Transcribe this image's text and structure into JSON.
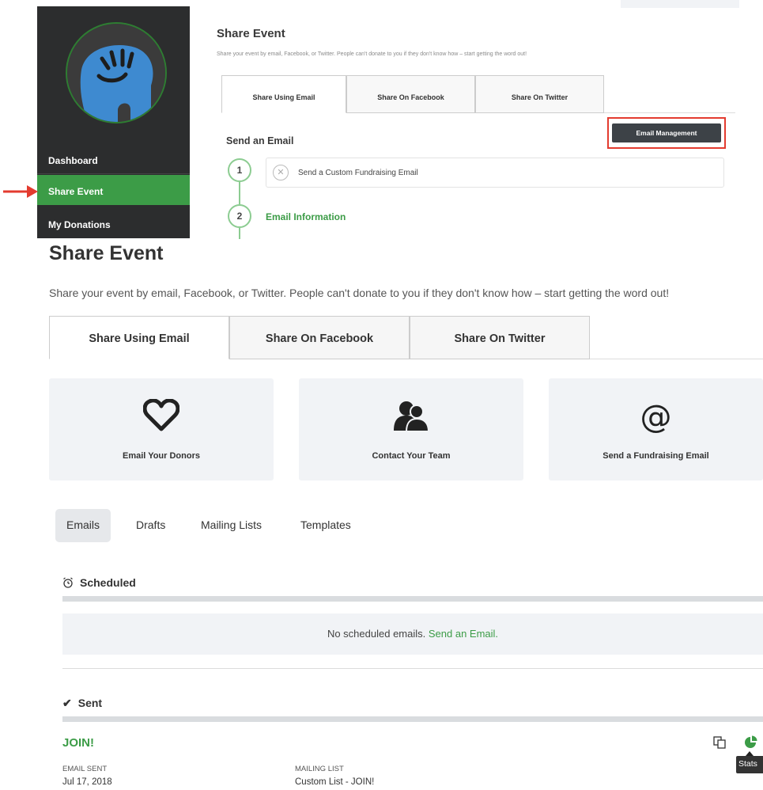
{
  "inset": {
    "sidebar": {
      "items": [
        "Dashboard",
        "Share Event",
        "My Donations"
      ]
    },
    "title": "Share Event",
    "subtitle": "Share your event by email, Facebook, or Twitter. People can't donate to you if they don't know how – start getting the word out!",
    "tabs": [
      "Share Using Email",
      "Share On Facebook",
      "Share On Twitter"
    ],
    "send_heading": "Send an Email",
    "email_management_button": "Email Management",
    "steps": [
      {
        "number": "1",
        "label": "Send a Custom Fundraising Email"
      },
      {
        "number": "2",
        "label": "Email Information"
      }
    ],
    "highlight_color": "#e33b2f",
    "accent_color": "#3c9c47"
  },
  "main": {
    "title": "Share Event",
    "subtitle": "Share your event by email, Facebook, or Twitter. People can't donate to you if they don't know how – start getting the word out!",
    "tabs": [
      "Share Using Email",
      "Share On Facebook",
      "Share On Twitter"
    ],
    "cards": [
      {
        "icon": "heart-icon",
        "label": "Email Your Donors"
      },
      {
        "icon": "team-icon",
        "label": "Contact Your Team"
      },
      {
        "icon": "at-icon",
        "label": "Send a Fundraising Email"
      }
    ],
    "subtabs": [
      "Emails",
      "Drafts",
      "Mailing Lists",
      "Templates"
    ],
    "scheduled": {
      "heading": "Scheduled",
      "empty_text": "No scheduled emails.",
      "empty_link": "Send an Email."
    },
    "sent": {
      "heading": "Sent",
      "emails": [
        {
          "title": "JOIN!",
          "sent_label": "EMAIL SENT",
          "sent_value": "Jul 17, 2018",
          "list_label": "MAILING LIST",
          "list_value": "Custom List - JOIN!",
          "tooltip": "Stats"
        }
      ]
    }
  }
}
